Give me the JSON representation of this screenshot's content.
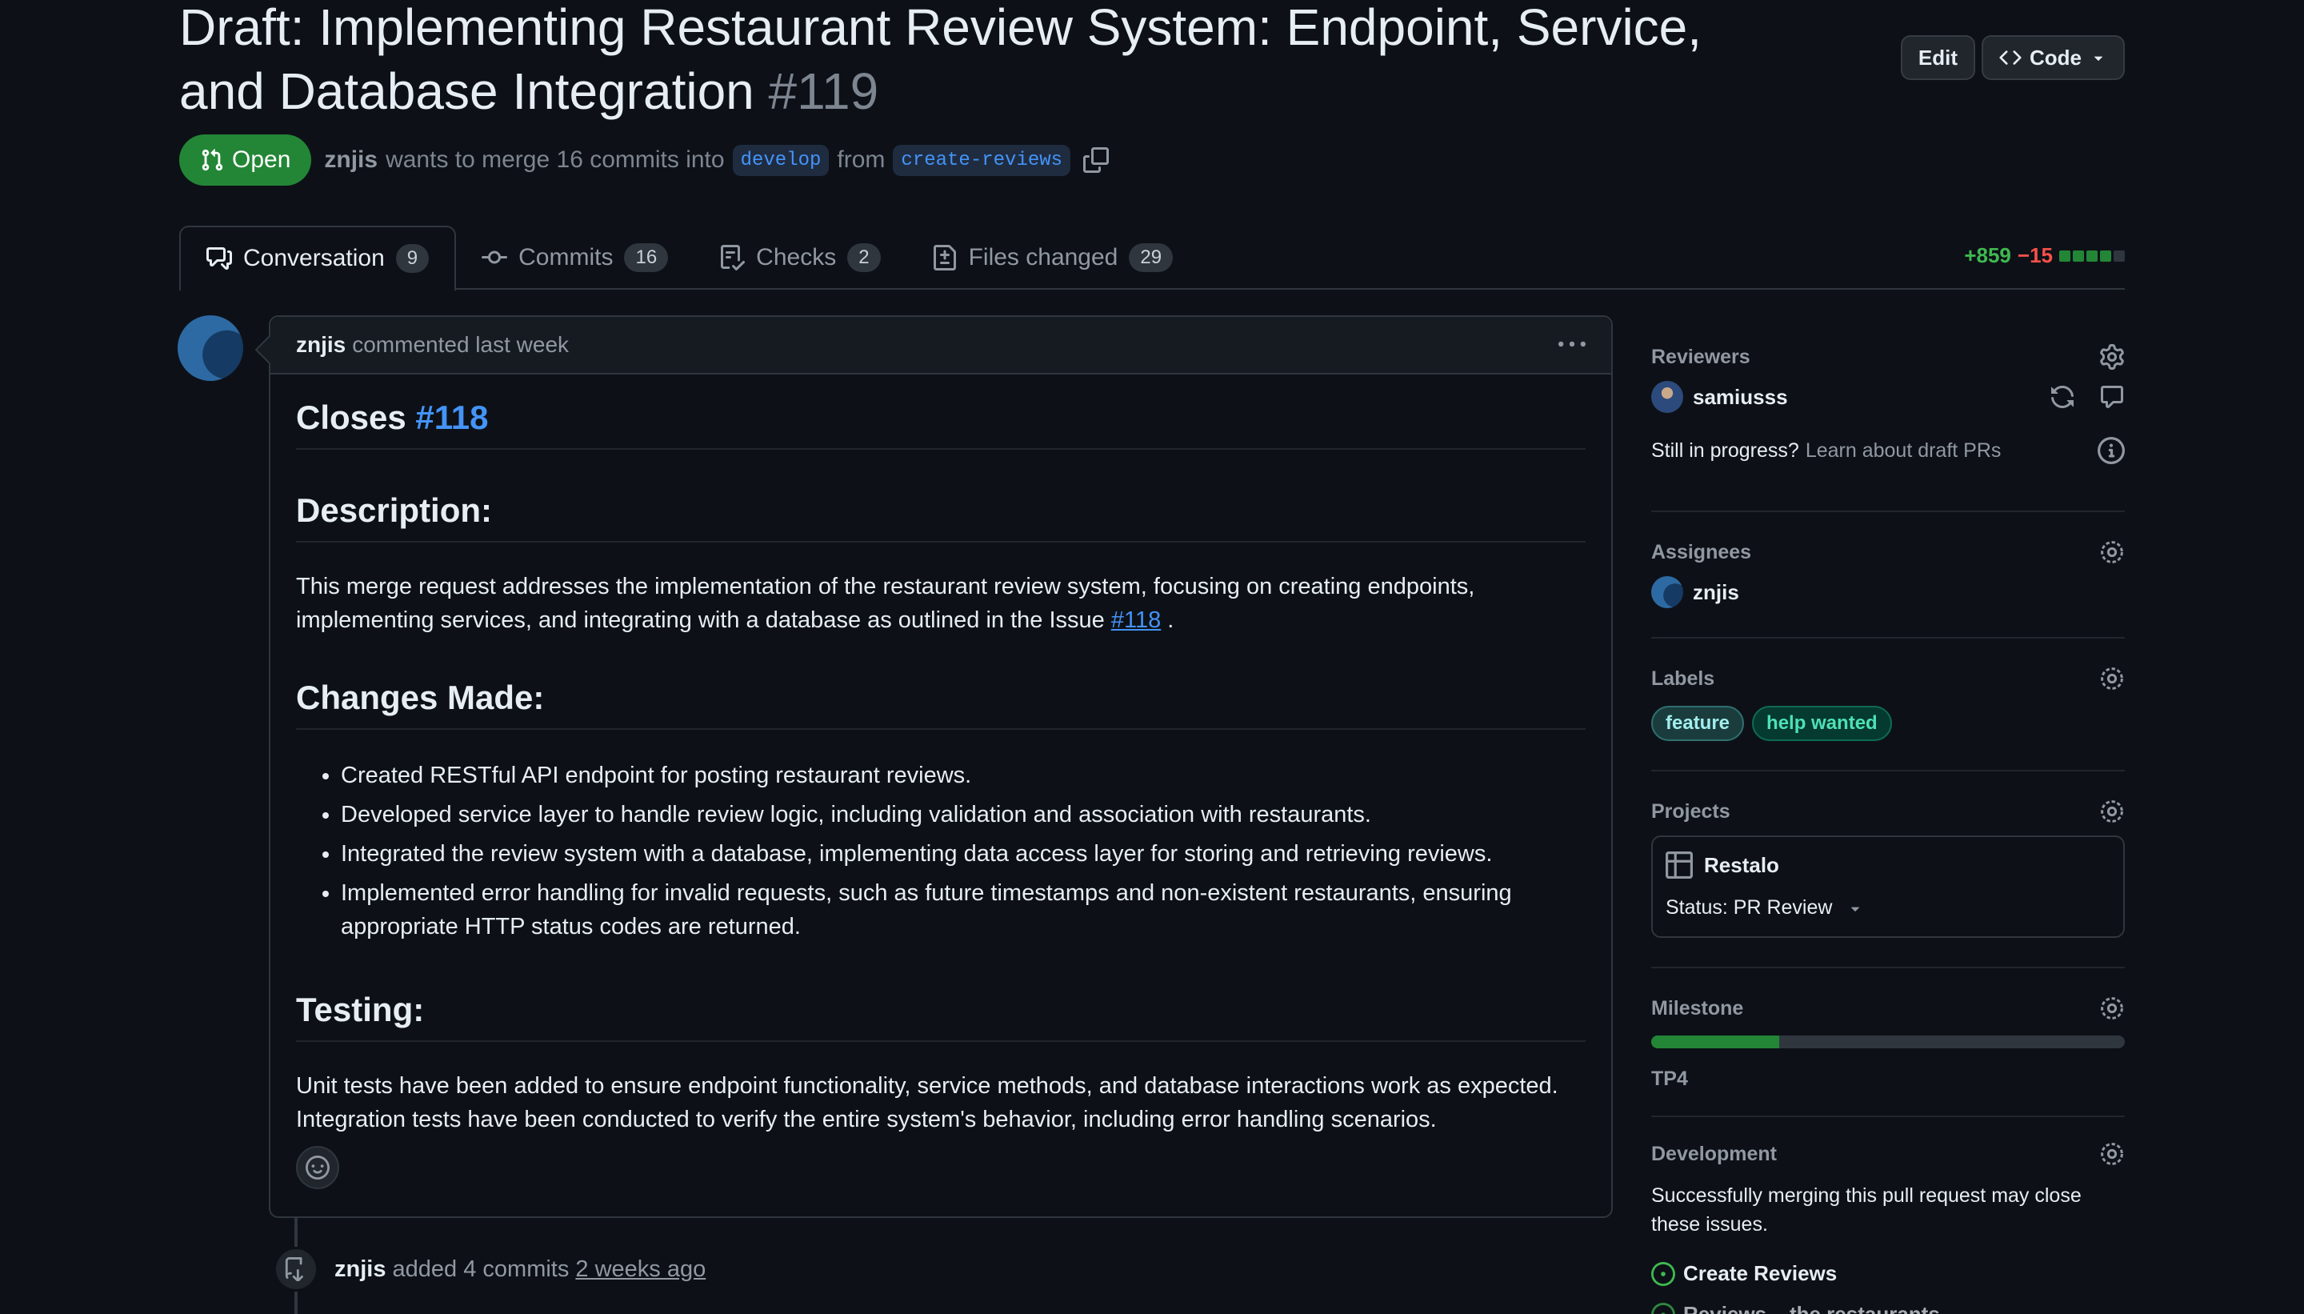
{
  "pr": {
    "title": "Draft: Implementing Restaurant Review System: Endpoint, Service, and Database Integration",
    "number": "#119",
    "state": "Open",
    "author": "znjis",
    "merge_text": "wants to merge 16 commits into",
    "base_branch": "develop",
    "from_text": "from",
    "head_branch": "create-reviews",
    "edit_label": "Edit",
    "code_label": "Code"
  },
  "tabs": [
    {
      "label": "Conversation",
      "count": "9"
    },
    {
      "label": "Commits",
      "count": "16"
    },
    {
      "label": "Checks",
      "count": "2"
    },
    {
      "label": "Files changed",
      "count": "29"
    }
  ],
  "diffstat": {
    "additions": "+859",
    "deletions": "−15"
  },
  "comment": {
    "author": "znjis",
    "meta": "commented last week",
    "closes_prefix": "Closes",
    "closes_ref": "#118",
    "description_heading": "Description:",
    "description_text": "This merge request addresses the implementation of the restaurant review system, focusing on creating endpoints, implementing services, and integrating with a database as outlined in the Issue",
    "description_link": "#118",
    "description_suffix": ".",
    "changes_heading": "Changes Made:",
    "changes": [
      "Created RESTful API endpoint for posting restaurant reviews.",
      "Developed service layer to handle review logic, including validation and association with restaurants.",
      "Integrated the review system with a database, implementing data access layer for storing and retrieving reviews.",
      "Implemented error handling for invalid requests, such as future timestamps and non-existent restaurants, ensuring appropriate HTTP status codes are returned."
    ],
    "testing_heading": "Testing:",
    "testing_text": "Unit tests have been added to ensure endpoint functionality, service methods, and database interactions work as expected. Integration tests have been conducted to verify the entire system's behavior, including error handling scenarios."
  },
  "timeline": {
    "author": "znjis",
    "action": "added 4 commits",
    "ago": "2 weeks ago"
  },
  "sidebar": {
    "reviewers": {
      "title": "Reviewers",
      "name": "samiusss"
    },
    "draft": {
      "question": "Still in progress?",
      "link": "Learn about draft PRs"
    },
    "assignees": {
      "title": "Assignees",
      "name": "znjis"
    },
    "labels": {
      "title": "Labels",
      "items": [
        "feature",
        "help wanted"
      ]
    },
    "projects": {
      "title": "Projects",
      "name": "Restalo",
      "status": "Status: PR Review"
    },
    "milestone": {
      "title": "Milestone",
      "name": "TP4",
      "progress": 0.27
    },
    "development": {
      "title": "Development",
      "text": "Successfully merging this pull request may close these issues.",
      "issue": "Create Reviews",
      "issue2": "Reviews ...the restaurants"
    }
  },
  "colors": {
    "accent": "#4493f8",
    "open": "#238636",
    "add": "#3fb950",
    "del": "#f85149"
  },
  "icons": [
    "git-pull-request-icon",
    "copy-icon",
    "comment-discussion-icon",
    "git-commit-icon",
    "checklist-icon",
    "file-diff-icon",
    "kebab-horizontal-icon",
    "smiley-icon",
    "gear-icon",
    "sync-icon",
    "comment-icon",
    "info-icon",
    "table-icon",
    "triangle-down-icon",
    "issue-opened-icon",
    "repo-push-icon"
  ]
}
